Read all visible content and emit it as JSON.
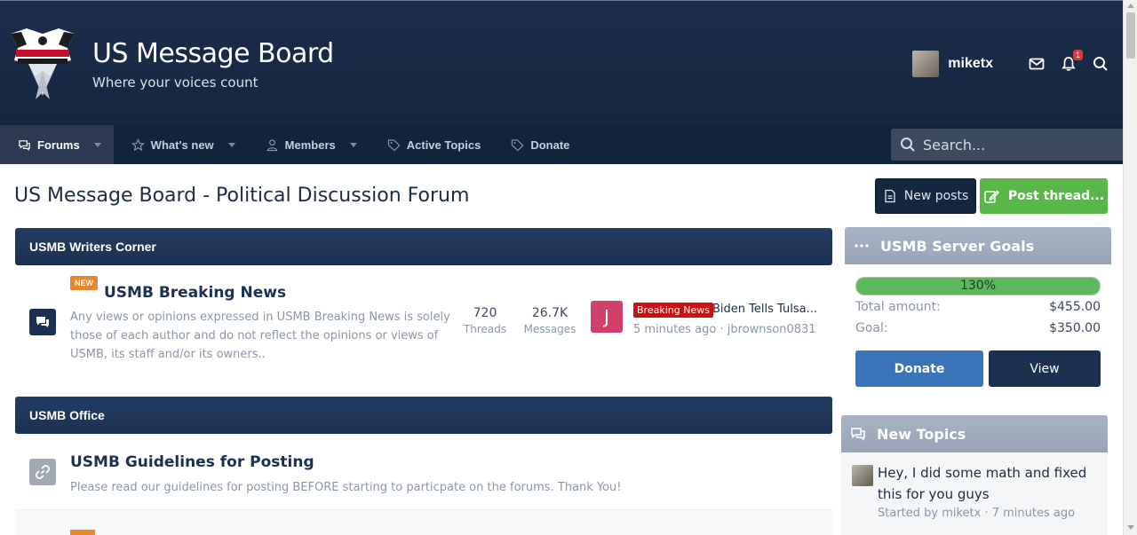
{
  "header": {
    "site_title": "US Message Board",
    "tagline": "Where your voices count",
    "username": "miketx",
    "alerts_count": "1"
  },
  "nav": {
    "items": [
      {
        "label": "Forums",
        "icon": "comments-icon",
        "active": true
      },
      {
        "label": "What's new",
        "icon": "star-icon"
      },
      {
        "label": "Members",
        "icon": "user-icon"
      },
      {
        "label": "Active Topics",
        "icon": "tag-icon"
      },
      {
        "label": "Donate",
        "icon": "tag-icon"
      }
    ],
    "search_placeholder": "Search..."
  },
  "page": {
    "title": "US Message Board - Political Discussion Forum",
    "new_posts_label": "New posts",
    "post_thread_label": "Post thread..."
  },
  "categories": [
    {
      "name": "USMB Writers Corner",
      "forum": {
        "tag": "NEW",
        "title": "USMB Breaking News",
        "description_lines": [
          "Any views or opinions expressed in USMB Breaking News is solely",
          "those of each author and do not reflect the opinions or views of",
          "USMB, its staff and/or its owners.."
        ],
        "threads": "720",
        "threads_label": "Threads",
        "messages": "26.7K",
        "messages_label": "Messages",
        "last_avatar_letter": "J",
        "last_prefix": "Breaking News",
        "last_title": "Biden Tells Tulsa...",
        "last_meta": "5 minutes ago · jbrownson0831"
      }
    },
    {
      "name": "USMB Office",
      "forum": {
        "title": "USMB Guidelines for Posting",
        "description": "Please read our guidelines for posting BEFORE starting to particpate on the forums. Thank You!"
      }
    }
  ],
  "sidebar": {
    "server_goals": {
      "title": "USMB Server Goals",
      "progress_text": "130%",
      "progress_fraction": 1.0,
      "total_label": "Total amount:",
      "total_value": "$455.00",
      "goal_label": "Goal:",
      "goal_value": "$350.00",
      "donate_label": "Donate",
      "view_label": "View"
    },
    "new_topics": {
      "title": "New Topics",
      "topic_title": "Hey, I did some math and fixed this for you guys",
      "topic_meta": "Started by miketx · 7 minutes ago"
    }
  },
  "colors": {
    "header_bg": "#1b2d4b",
    "nav_bg": "#12233d",
    "category_bg": "#1c3152",
    "accent_green": "#58b748",
    "donate_blue": "#3a74b8",
    "breaking_red": "#cc1111"
  }
}
